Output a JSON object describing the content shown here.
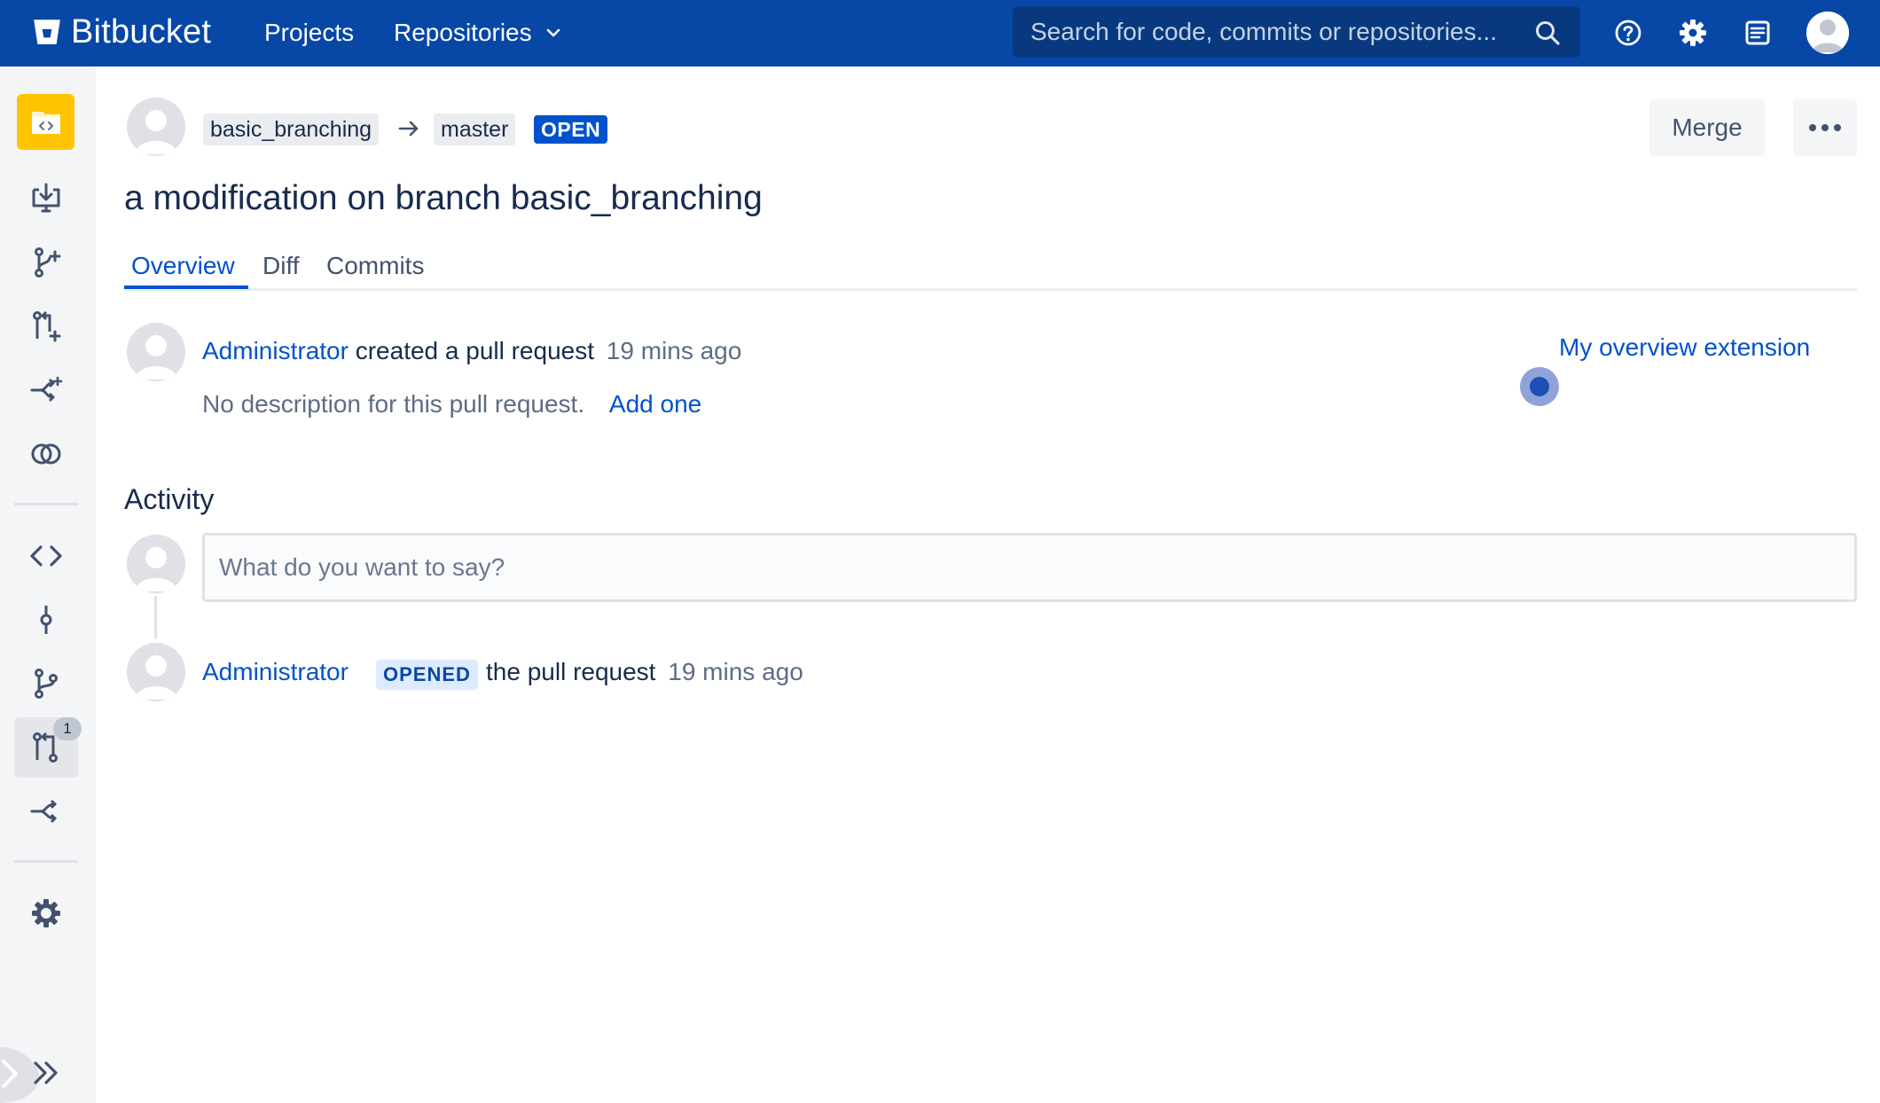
{
  "header": {
    "logo_text": "Bitbucket",
    "nav": {
      "projects": "Projects",
      "repositories": "Repositories"
    },
    "search_placeholder": "Search for code, commits or repositories..."
  },
  "sidebar": {
    "pull_request_count": "1"
  },
  "pull_request": {
    "source_branch": "basic_branching",
    "target_branch": "master",
    "state": "OPEN",
    "title": "a modification on branch basic_branching",
    "actions": {
      "merge": "Merge"
    },
    "tabs": [
      "Overview",
      "Diff",
      "Commits"
    ],
    "summary": {
      "author": "Administrator",
      "action_text": "created a pull request",
      "time": "19 mins ago",
      "no_description": "No description for this pull request.",
      "add_description": "Add one"
    },
    "extension_link": "My overview extension"
  },
  "activity": {
    "title": "Activity",
    "comment_placeholder": "What do you want to say?",
    "events": [
      {
        "author": "Administrator",
        "badge": "OPENED",
        "text": "the pull request",
        "time": "19 mins ago"
      }
    ]
  },
  "colors": {
    "header_bg": "#0747a6",
    "link": "#0052cc",
    "repo_tile": "#ffc400"
  }
}
